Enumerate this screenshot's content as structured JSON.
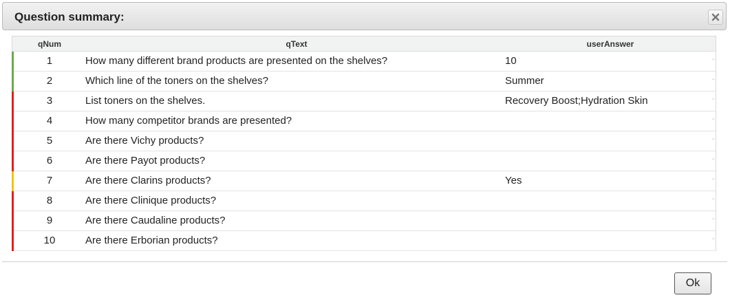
{
  "dialog": {
    "title": "Question summary:",
    "close_icon": "close-x-icon",
    "ok_label": "Ok"
  },
  "table": {
    "columns": [
      "qNum",
      "qText",
      "userAnswer"
    ],
    "rows": [
      {
        "num": "1",
        "text": "How many different brand products are presented on the shelves?",
        "answer": "10",
        "status_color": "#6aaa4a"
      },
      {
        "num": "2",
        "text": "Which line of the toners on the shelves?",
        "answer": "Summer",
        "status_color": "#6aaa4a"
      },
      {
        "num": "3",
        "text": "List toners on the shelves.",
        "answer": "Recovery Boost;Hydration Skin",
        "status_color": "#e02020"
      },
      {
        "num": "4",
        "text": "How many competitor brands are presented?",
        "answer": "",
        "status_color": "#e02020"
      },
      {
        "num": "5",
        "text": "Are there Vichy products?",
        "answer": "",
        "status_color": "#e02020"
      },
      {
        "num": "6",
        "text": "Are there Payot products?",
        "answer": "",
        "status_color": "#e02020"
      },
      {
        "num": "7",
        "text": "Are there Clarins products?",
        "answer": "Yes",
        "status_color": "#f0c419"
      },
      {
        "num": "8",
        "text": "Are there Clinique products?",
        "answer": "",
        "status_color": "#e02020"
      },
      {
        "num": "9",
        "text": "Are there Caudaline products?",
        "answer": "",
        "status_color": "#e02020"
      },
      {
        "num": "10",
        "text": "Are there Erborian products?",
        "answer": "",
        "status_color": "#e02020"
      }
    ],
    "trailing_mark": "-"
  }
}
